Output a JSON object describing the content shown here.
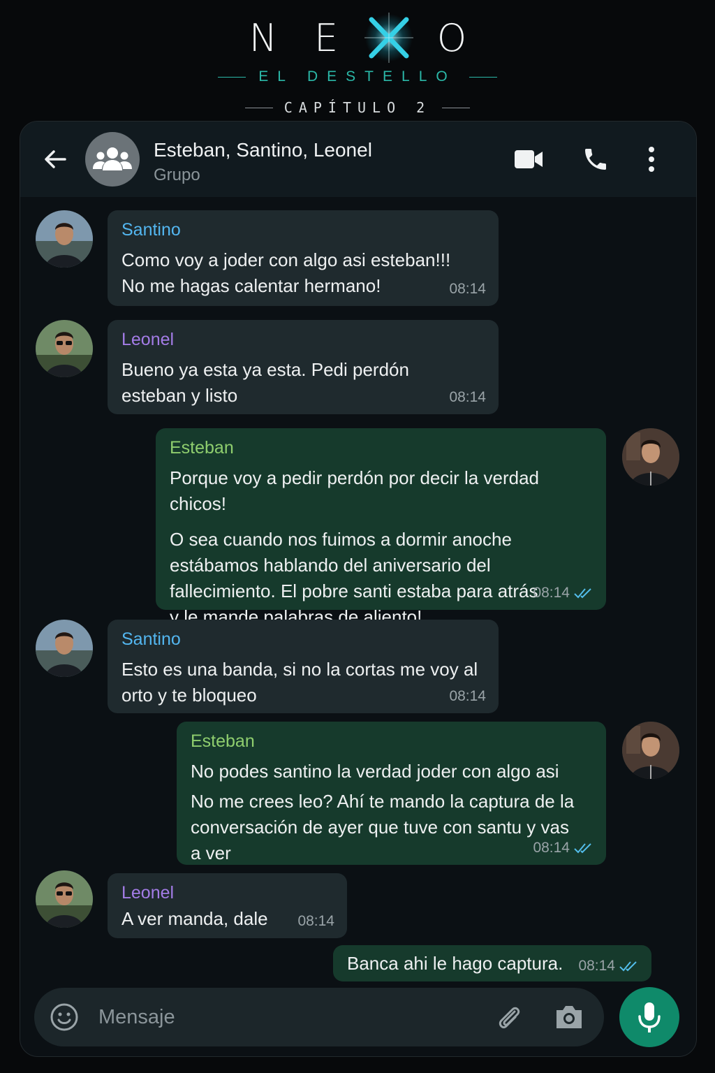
{
  "title": {
    "logo_letters": [
      "N",
      "E",
      "O"
    ],
    "subtitle": "EL DESTELLO",
    "chapter": "CAPÍTULO 2"
  },
  "chat": {
    "name": "Esteban, Santino, Leonel",
    "subtitle": "Grupo"
  },
  "messages": [
    {
      "sender": "Santino",
      "lines": [
        "Como voy a joder con algo asi esteban!!!",
        "No me hagas calentar hermano!"
      ],
      "time": "08:14",
      "direction": "incoming"
    },
    {
      "sender": "Leonel",
      "lines": [
        "Bueno ya esta ya esta. Pedi perdón",
        "esteban y listo"
      ],
      "time": "08:14",
      "direction": "incoming"
    },
    {
      "sender": "Esteban",
      "para1": "Porque voy a pedir perdón por decir la verdad chicos!",
      "lines": [
        "O sea cuando nos fuimos a dormir anoche",
        "estábamos hablando del aniversario del",
        "fallecimiento. El pobre santi estaba para atrás",
        "y le mande palabras de aliento!"
      ],
      "time": "08:14",
      "direction": "outgoing"
    },
    {
      "sender": "Santino",
      "lines": [
        "Esto es una banda, si no la cortas me voy al",
        "orto y te bloqueo"
      ],
      "time": "08:14",
      "direction": "incoming"
    },
    {
      "sender": "Esteban",
      "para1": "No podes santino la verdad joder con algo asi",
      "lines": [
        "No me crees leo? Ahí te mando la captura de la",
        "conversación de ayer que tuve con santu y vas",
        "a ver"
      ],
      "time": "08:14",
      "direction": "outgoing"
    },
    {
      "sender": "Leonel",
      "lines": [
        "A ver manda, dale"
      ],
      "time": "08:14",
      "direction": "incoming"
    },
    {
      "sender": "",
      "lines": [
        "Banca ahi le hago captura."
      ],
      "time": "08:14",
      "direction": "outgoing"
    }
  ],
  "input": {
    "placeholder": "Mensaje"
  },
  "colors": {
    "santino": "#53b6f0",
    "leonel": "#a37ce6",
    "esteban": "#8fce6e",
    "incoming_bubble": "#1f2a2e",
    "outgoing_bubble": "#163a2c",
    "read_ticks": "#53bdeb",
    "mic_button": "#0f8a6a"
  },
  "icons": [
    "back-arrow-icon",
    "group-icon",
    "video-call-icon",
    "phone-icon",
    "more-vert-icon",
    "emoji-icon",
    "attach-icon",
    "camera-icon",
    "mic-icon",
    "double-check-icon"
  ]
}
